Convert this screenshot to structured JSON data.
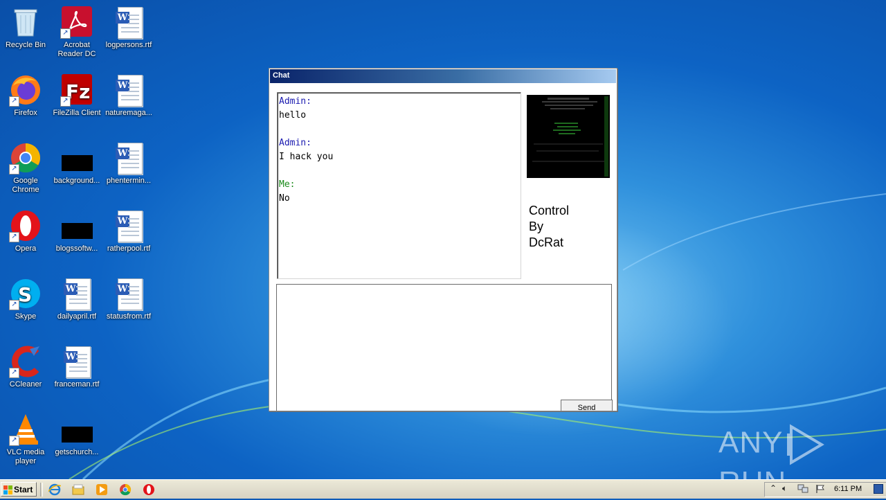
{
  "desktop": {
    "icons": [
      {
        "label": "Recycle Bin"
      },
      {
        "label": "Acrobat Reader DC"
      },
      {
        "label": "logpersons.rtf"
      },
      {
        "label": "Firefox"
      },
      {
        "label": "FileZilla Client"
      },
      {
        "label": "naturemaga..."
      },
      {
        "label": "Google Chrome"
      },
      {
        "label": "background..."
      },
      {
        "label": "phentermin..."
      },
      {
        "label": "Opera"
      },
      {
        "label": "blogssoftw..."
      },
      {
        "label": "ratherpool.rtf"
      },
      {
        "label": "Skype"
      },
      {
        "label": "dailyapril.rtf"
      },
      {
        "label": "statusfrom.rtf"
      },
      {
        "label": "CCleaner"
      },
      {
        "label": "franceman.rtf"
      },
      {
        "label": "VLC media player"
      },
      {
        "label": "getschurch..."
      }
    ]
  },
  "chat": {
    "title": "Chat",
    "messages": [
      {
        "sender": "Admin:",
        "text": "hello"
      },
      {
        "sender": "Admin:",
        "text": "I hack you"
      },
      {
        "sender": "Me:",
        "text": "No"
      }
    ],
    "side_text": "Control\nBy\nDcRat",
    "send_label": "Send",
    "input_value": ""
  },
  "watermark": {
    "left": "ANY",
    "right": "RUN"
  },
  "taskbar": {
    "start_label": "Start",
    "clock": "6:11 PM",
    "pinned": [
      "internet-explorer-icon",
      "file-explorer-icon",
      "media-player-icon",
      "chrome-icon",
      "opera-icon"
    ]
  },
  "colors": {
    "admin": "#1a1ab0",
    "me": "#1a8a1a",
    "titlebar": "#0a246a"
  }
}
